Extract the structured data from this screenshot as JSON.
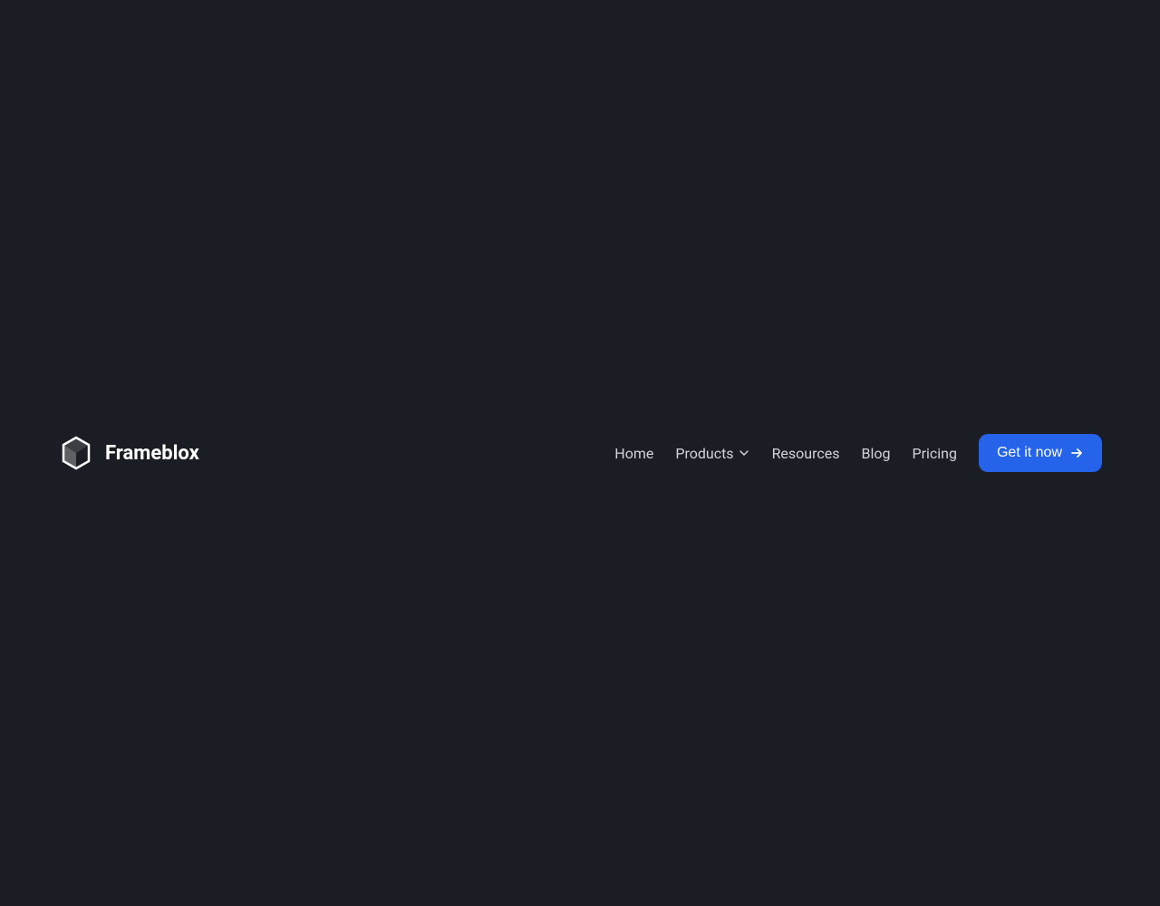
{
  "brand": {
    "name": "Frameblox"
  },
  "nav": {
    "links": [
      {
        "label": "Home"
      },
      {
        "label": "Products",
        "hasDropdown": true
      },
      {
        "label": "Resources"
      },
      {
        "label": "Blog"
      },
      {
        "label": "Pricing"
      }
    ],
    "cta": {
      "label": "Get it now"
    }
  }
}
